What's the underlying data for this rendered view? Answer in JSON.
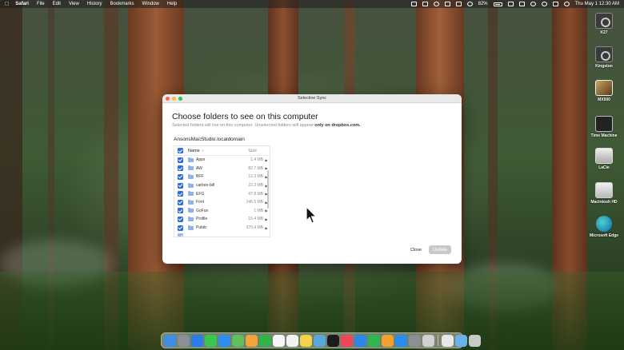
{
  "menubar": {
    "app_name": "Safari",
    "items": [
      "File",
      "Edit",
      "View",
      "History",
      "Bookmarks",
      "Window",
      "Help"
    ],
    "battery": "82%",
    "clock": "Thu May 1  12:30 AM"
  },
  "desktop_icons": [
    {
      "label": "K27",
      "icon": "camera-icon"
    },
    {
      "label": "Kingston",
      "icon": "camera-icon"
    },
    {
      "label": "MX500",
      "icon": "photo-drive-icon"
    },
    {
      "label": "Time Machine",
      "icon": "time-machine-icon"
    },
    {
      "label": "LaCie",
      "icon": "external-drive-icon"
    },
    {
      "label": "Macintosh HD",
      "icon": "hard-drive-icon"
    },
    {
      "label": "Microsoft Edge",
      "icon": "edge-icon"
    }
  ],
  "dialog": {
    "window_title": "Selective Sync",
    "heading": "Choose folders to see on this computer",
    "subtitle_prefix": "Selected folders will live on this computer. Unselected folders will appear ",
    "subtitle_bold": "only on dropbox.com.",
    "device_name": "AnsonsMacStudio.localdomain",
    "columns": {
      "name": "Name",
      "size": "Size"
    },
    "folders": [
      {
        "name": "Apps",
        "size": "1.4 MB",
        "checked": true
      },
      {
        "name": "AW",
        "size": "82.7 MB",
        "checked": true
      },
      {
        "name": "BFF",
        "size": "12.3 MB",
        "checked": true
      },
      {
        "name": "carbon-bill",
        "size": "22.3 MB",
        "checked": true
      },
      {
        "name": "EFG",
        "size": "47.8 MB",
        "checked": true
      },
      {
        "name": "Font",
        "size": "146.5 MB",
        "checked": true
      },
      {
        "name": "GoFun",
        "size": "1 MB",
        "checked": true
      },
      {
        "name": "Profile",
        "size": "15.4 MB",
        "checked": true
      },
      {
        "name": "Public",
        "size": "370.4 MB",
        "checked": true
      }
    ],
    "buttons": {
      "close": "Close",
      "update": "Update"
    }
  },
  "dock": {
    "apps": [
      {
        "icon": "finder-icon",
        "color": "#3d8ee8"
      },
      {
        "icon": "launchpad-icon",
        "color": "#8a8f98"
      },
      {
        "icon": "safari-icon",
        "color": "#2b7de9"
      },
      {
        "icon": "messages-icon",
        "color": "#39c74c"
      },
      {
        "icon": "mail-icon",
        "color": "#2f8cf0"
      },
      {
        "icon": "maps-icon",
        "color": "#5fbf5a"
      },
      {
        "icon": "photos-icon",
        "color": "#f2a33a"
      },
      {
        "icon": "facetime-icon",
        "color": "#2fb44a"
      },
      {
        "icon": "calendar-icon",
        "color": "#f5f5f5"
      },
      {
        "icon": "reminders-icon",
        "color": "#f2f2f2"
      },
      {
        "icon": "notes-icon",
        "color": "#f6d24a"
      },
      {
        "icon": "preview-icon",
        "color": "#5aa7d8"
      },
      {
        "icon": "tv-icon",
        "color": "#1c1c1e"
      },
      {
        "icon": "music-icon",
        "color": "#f3455a"
      },
      {
        "icon": "keynote-icon",
        "color": "#2d87e8"
      },
      {
        "icon": "numbers-icon",
        "color": "#2fb64e"
      },
      {
        "icon": "pages-icon",
        "color": "#f2a130"
      },
      {
        "icon": "app-store-icon",
        "color": "#2a8cf3"
      },
      {
        "icon": "settings-icon",
        "color": "#8e8e93"
      },
      {
        "icon": "iphone-mirroring-icon",
        "color": "#d0d0d0"
      }
    ],
    "stacks": [
      {
        "icon": "document-icon",
        "color": "#e8e8e8"
      },
      {
        "icon": "downloads-folder-icon",
        "color": "#69b2ec"
      },
      {
        "icon": "trash-icon",
        "color": "#c9c9c9"
      }
    ]
  }
}
